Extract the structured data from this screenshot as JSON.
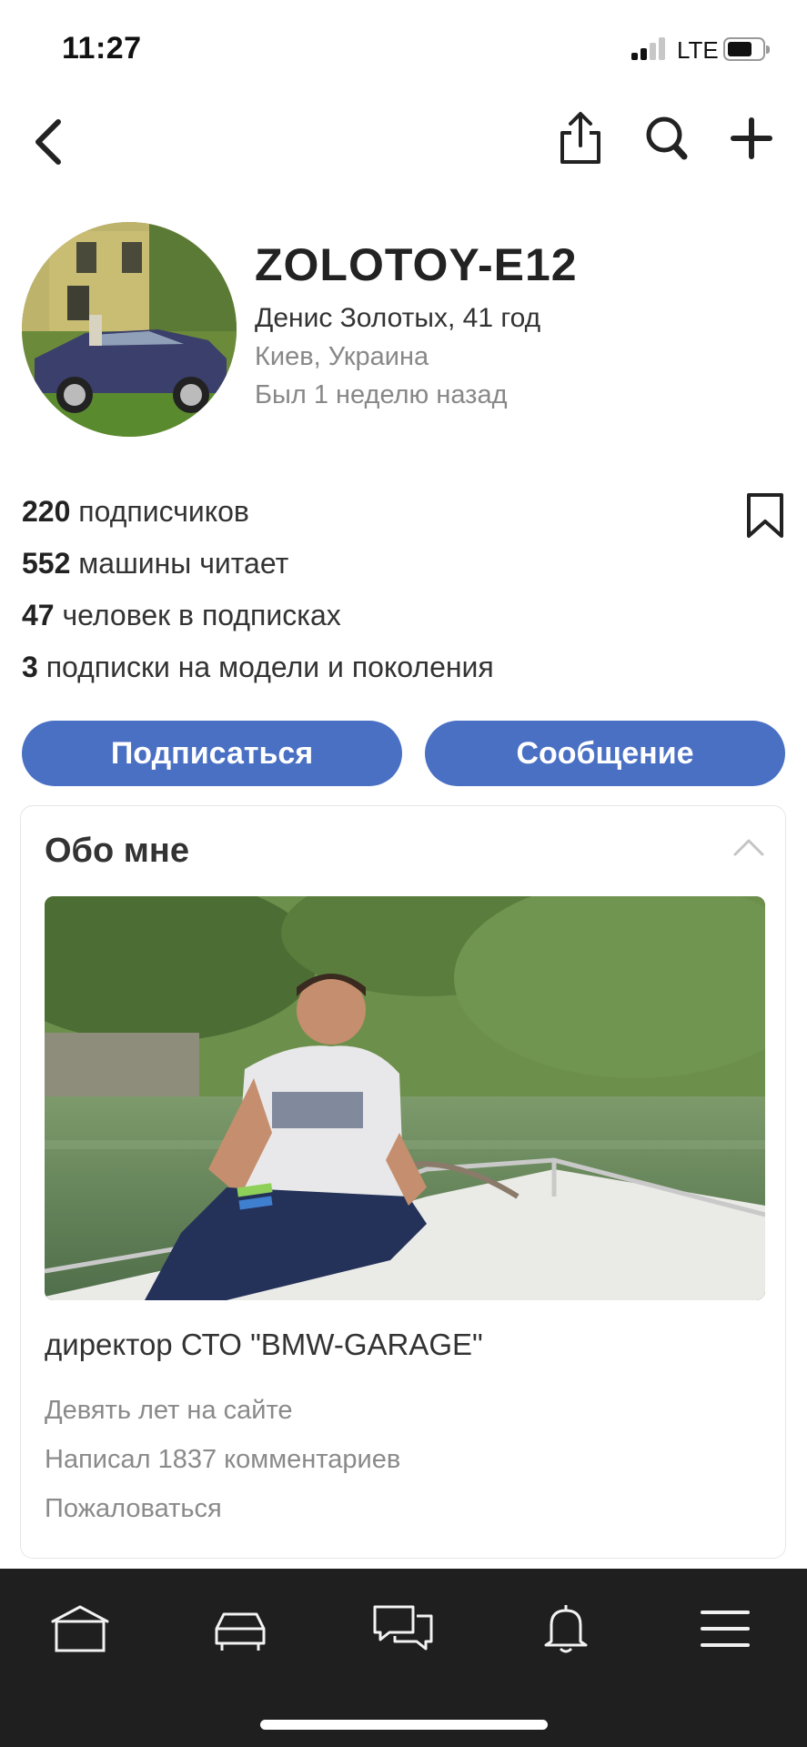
{
  "status_bar": {
    "time": "11:27",
    "network": "LTE",
    "battery_level": 0.6
  },
  "nav": {
    "back_icon": "chevron-left-icon",
    "share_icon": "share-icon",
    "search_icon": "search-icon",
    "add_icon": "plus-icon"
  },
  "profile": {
    "username": "ZOLOTOY-E12",
    "name_age": "Денис Золотых, 41 год",
    "location": "Киев, Украина",
    "last_seen": "Был 1 неделю назад"
  },
  "stats": [
    {
      "count": "220",
      "label": "подписчиков"
    },
    {
      "count": "552",
      "label": "машины читает"
    },
    {
      "count": "47",
      "label": "человек в подписках"
    },
    {
      "count": "3",
      "label": "подписки на модели и поколения"
    }
  ],
  "actions": {
    "subscribe": "Подписаться",
    "message": "Сообщение"
  },
  "about": {
    "title": "Обо мне",
    "text": "директор СТО \"BMW-GARAGE\"",
    "years_on_site": "Девять лет на сайте",
    "comments": "Написал 1837 комментариев",
    "report": "Пожаловаться"
  },
  "tab_bar": {
    "items": [
      "home-icon",
      "car-icon",
      "chat-icon",
      "bell-icon",
      "menu-icon"
    ]
  },
  "colors": {
    "accent": "#4a70c4",
    "tab_bar_bg": "#1f1f1f",
    "muted_text": "#888888"
  }
}
